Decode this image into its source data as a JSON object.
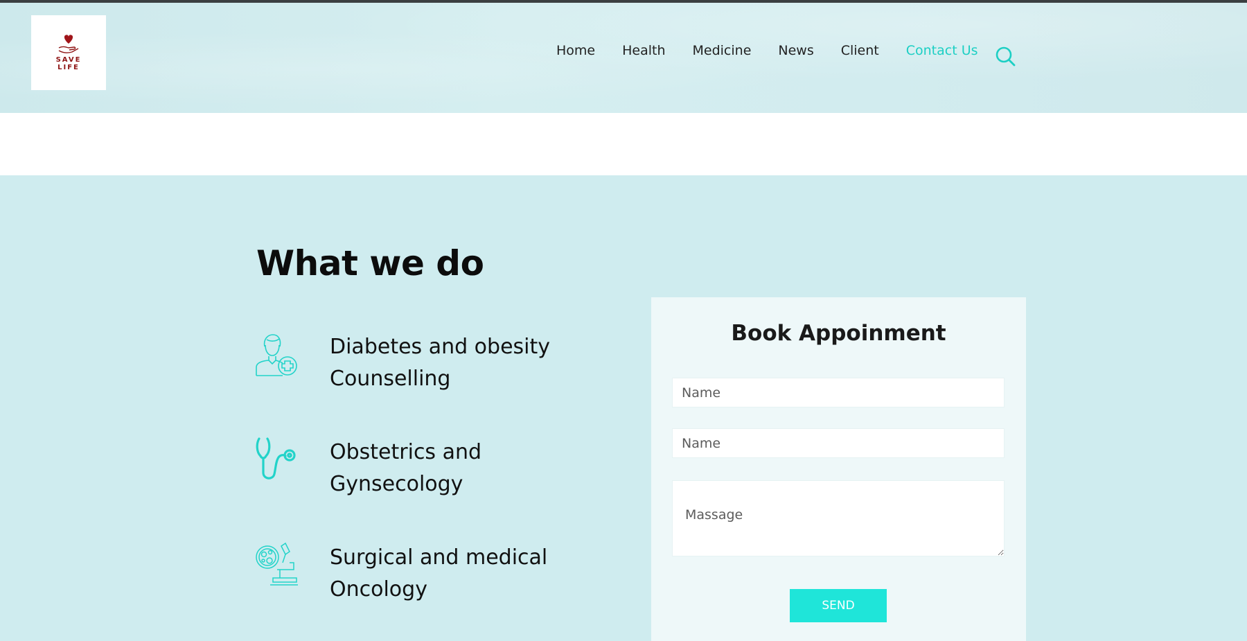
{
  "brand": {
    "logo_line1": "SAVE",
    "logo_line2": "LIFE",
    "logo_color": "#8e1414"
  },
  "nav": {
    "items": [
      {
        "label": "Home",
        "active": false
      },
      {
        "label": "Health",
        "active": false
      },
      {
        "label": "Medicine",
        "active": false
      },
      {
        "label": "News",
        "active": false
      },
      {
        "label": "Client",
        "active": false
      },
      {
        "label": "Contact Us",
        "active": true
      }
    ],
    "search_icon": "search-icon",
    "accent_color": "#1ccfc4"
  },
  "services": {
    "title": "What we do",
    "items": [
      {
        "icon": "doctor-plus-icon",
        "label": "Diabetes and obesity Counselling"
      },
      {
        "icon": "stethoscope-icon",
        "label": "Obstetrics and Gynsecology"
      },
      {
        "icon": "microscope-icon",
        "label": "Surgical and medical Oncology"
      }
    ]
  },
  "appointment": {
    "title": "Book Appoinment",
    "fields": {
      "name_placeholder": "Name",
      "second_placeholder": "Name",
      "message_placeholder": "Massage"
    },
    "send_label": "SEND",
    "button_color": "#1fe5d9"
  }
}
